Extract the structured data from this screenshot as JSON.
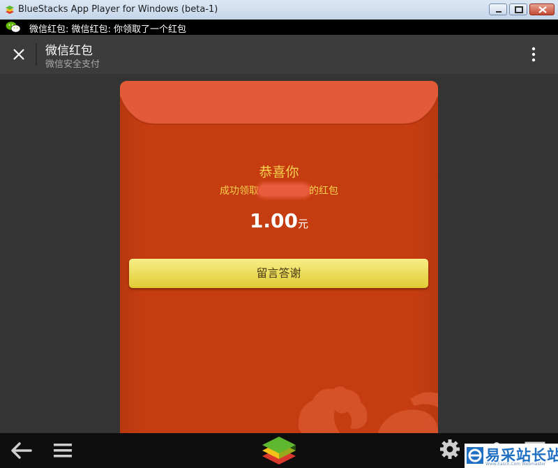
{
  "window": {
    "title": "BlueStacks App Player for Windows (beta-1)",
    "icon": "bluestacks-icon",
    "buttons": [
      "minimize-icon",
      "maximize-icon",
      "close-icon"
    ]
  },
  "status_bar": {
    "app_icon": "wechat-icon",
    "notification": "微信红包: 微信红包: 你领取了一个红包"
  },
  "action_bar": {
    "title": "微信红包",
    "subtitle": "微信安全支付",
    "close_icon": "close-icon",
    "more_icon": "more-vert-icon"
  },
  "red_packet": {
    "greeting": "恭喜你",
    "received_prefix": "成功领取",
    "received_suffix": "的红包",
    "amount": "1.00",
    "currency": "元",
    "thanks_button": "留言答谢"
  },
  "nav_bar": {
    "icons": [
      "back-arrow-icon",
      "menu-icon",
      "bluestacks-logo",
      "settings-gear-icon",
      "share-icon",
      "fullscreen-icon"
    ]
  },
  "watermark": {
    "text": "易采站长站",
    "url": "Www.Easck.Com Webmaster"
  },
  "colors": {
    "envelope": "#c43c10",
    "flap": "#e25a38",
    "gold_text": "#f7d24c",
    "button": "#f2e066",
    "action_bar": "#3c3c3c"
  }
}
